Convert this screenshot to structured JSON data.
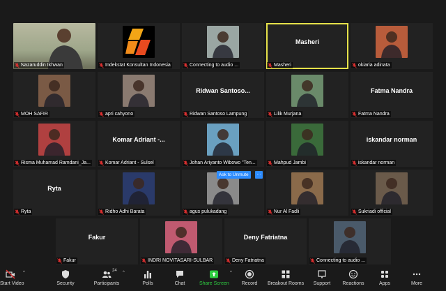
{
  "participants": [
    {
      "name": "Nazaruddin Ikhwan",
      "type": "video",
      "tone": "#8a8a6a"
    },
    {
      "name": "Indekstat Konsultan Indonesia",
      "type": "logo"
    },
    {
      "name": "Connecting to audio ...",
      "type": "photo",
      "tone": "#9aa6a3"
    },
    {
      "name": "Masheri",
      "display": "Masheri",
      "type": "name",
      "active": true
    },
    {
      "name": "okiaria adinata",
      "type": "photo",
      "tone": "#b85c3b"
    },
    {
      "name": "MOH SAFIR",
      "type": "photo",
      "tone": "#7a5a45"
    },
    {
      "name": "apri cahyono",
      "type": "photo",
      "tone": "#8a7a70"
    },
    {
      "name": "Ridwan Santoso Lampung",
      "display": "Ridwan  Santoso...",
      "type": "name"
    },
    {
      "name": "Lilik Murjana",
      "type": "photo",
      "tone": "#6a8a6a"
    },
    {
      "name": "Fatma Nandra",
      "display": "Fatma Nandra",
      "type": "name"
    },
    {
      "name": "Risma Muhamad Ramdani_Ja...",
      "type": "photo",
      "tone": "#b04040"
    },
    {
      "name": "Komar Adriant - Sulsel",
      "display": "Komar Adriant  -...",
      "type": "name"
    },
    {
      "name": "Johan Ariyanto Wibowo \"Ten...",
      "type": "photo",
      "tone": "#6aa0c0"
    },
    {
      "name": "Mahpud Jambi",
      "type": "photo",
      "tone": "#3a6a3a"
    },
    {
      "name": "iskandar norman",
      "display": "iskandar norman",
      "type": "name"
    },
    {
      "name": "Ryta",
      "display": "Ryta",
      "type": "name"
    },
    {
      "name": "Ridho Adhi Barata",
      "type": "photo",
      "tone": "#2a3a6a"
    },
    {
      "name": "agus pulukadang",
      "type": "photo",
      "tone": "#8a8a8a"
    },
    {
      "name": "Nur Al Fadli",
      "type": "photo",
      "tone": "#8a6a4a"
    },
    {
      "name": "Sukriadi official",
      "type": "photo",
      "tone": "#6a5a4a"
    },
    {
      "name": "Fakur",
      "display": "Fakur",
      "type": "name"
    },
    {
      "name": "INDRI NOVITASARI-SULBAR",
      "type": "photo",
      "tone": "#c05a70"
    },
    {
      "name": "Deny Fatriatna",
      "display": "Deny Fatriatna",
      "type": "name"
    },
    {
      "name": "Connecting to audio ...",
      "type": "photo",
      "tone": "#4a5a6a"
    }
  ],
  "popup": {
    "ask_to_unmute": "Ask to Unmute",
    "more": "..."
  },
  "toolbar": {
    "start_video": "Start Video",
    "security": "Security",
    "participants": "Participants",
    "participants_count": "24",
    "polls": "Polls",
    "chat": "Chat",
    "share_screen": "Share Screen",
    "record": "Record",
    "breakout_rooms": "Breakout Rooms",
    "support": "Support",
    "reactions": "Reactions",
    "apps": "Apps",
    "more": "More"
  },
  "colors": {
    "muted": "#e03030",
    "active_speaker": "#e6e24a",
    "share": "#2ecc40",
    "popup": "#2d8cff"
  }
}
